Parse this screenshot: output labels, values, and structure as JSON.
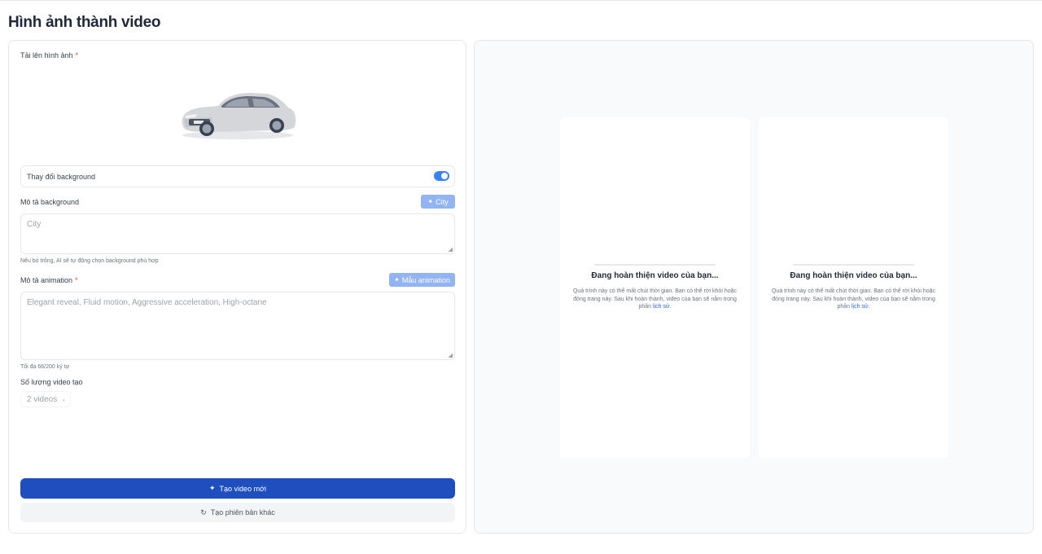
{
  "page": {
    "title": "Hình ảnh thành video"
  },
  "upload": {
    "label": "Tải lên hình ảnh",
    "required_mark": "*"
  },
  "background_toggle": {
    "label": "Thay đổi background",
    "enabled": true
  },
  "background": {
    "label": "Mô tả background",
    "chip_label": "City",
    "chip_icon": "sparkle-icon",
    "placeholder": "City",
    "helper": "Nếu bỏ trống, AI sẽ tự động chọn background phù hợp"
  },
  "animation": {
    "label": "Mô tả animation",
    "required_mark": "*",
    "chip_label": "Mẫu animation",
    "chip_icon": "sparkle-icon",
    "placeholder": "Elegant reveal, Fluid motion, Aggressive acceleration, High-octane",
    "helper": "Tối đa 66/200 ký tự"
  },
  "video_count": {
    "label": "Số lượng video tạo",
    "selected": "2 videos"
  },
  "actions": {
    "primary_label": "Tạo video mới",
    "primary_icon": "sparkle-icon",
    "secondary_label": "Tạo phiên bản khác",
    "secondary_icon": "refresh-icon"
  },
  "results": [
    {
      "title": "Đang hoàn thiện video của bạn...",
      "description": "Quá trình này có thể mất chút thời gian. Bạn có thể rời khỏi hoặc đóng trang này. Sau khi hoàn thành, video của bạn sẽ nằm trong phần",
      "link": "lịch sử",
      "suffix": "."
    },
    {
      "title": "Đang hoàn thiện video của bạn...",
      "description": "Quá trình này có thể mất chút thời gian. Bạn có thể rời khỏi hoặc đóng trang này. Sau khi hoàn thành, video của bạn sẽ nằm trong phần",
      "link": "lịch sử",
      "suffix": "."
    }
  ],
  "colors": {
    "primary": "#1f4fbf",
    "accent": "#3b82f6",
    "chip": "#93b4f3",
    "required": "#ef4444"
  }
}
